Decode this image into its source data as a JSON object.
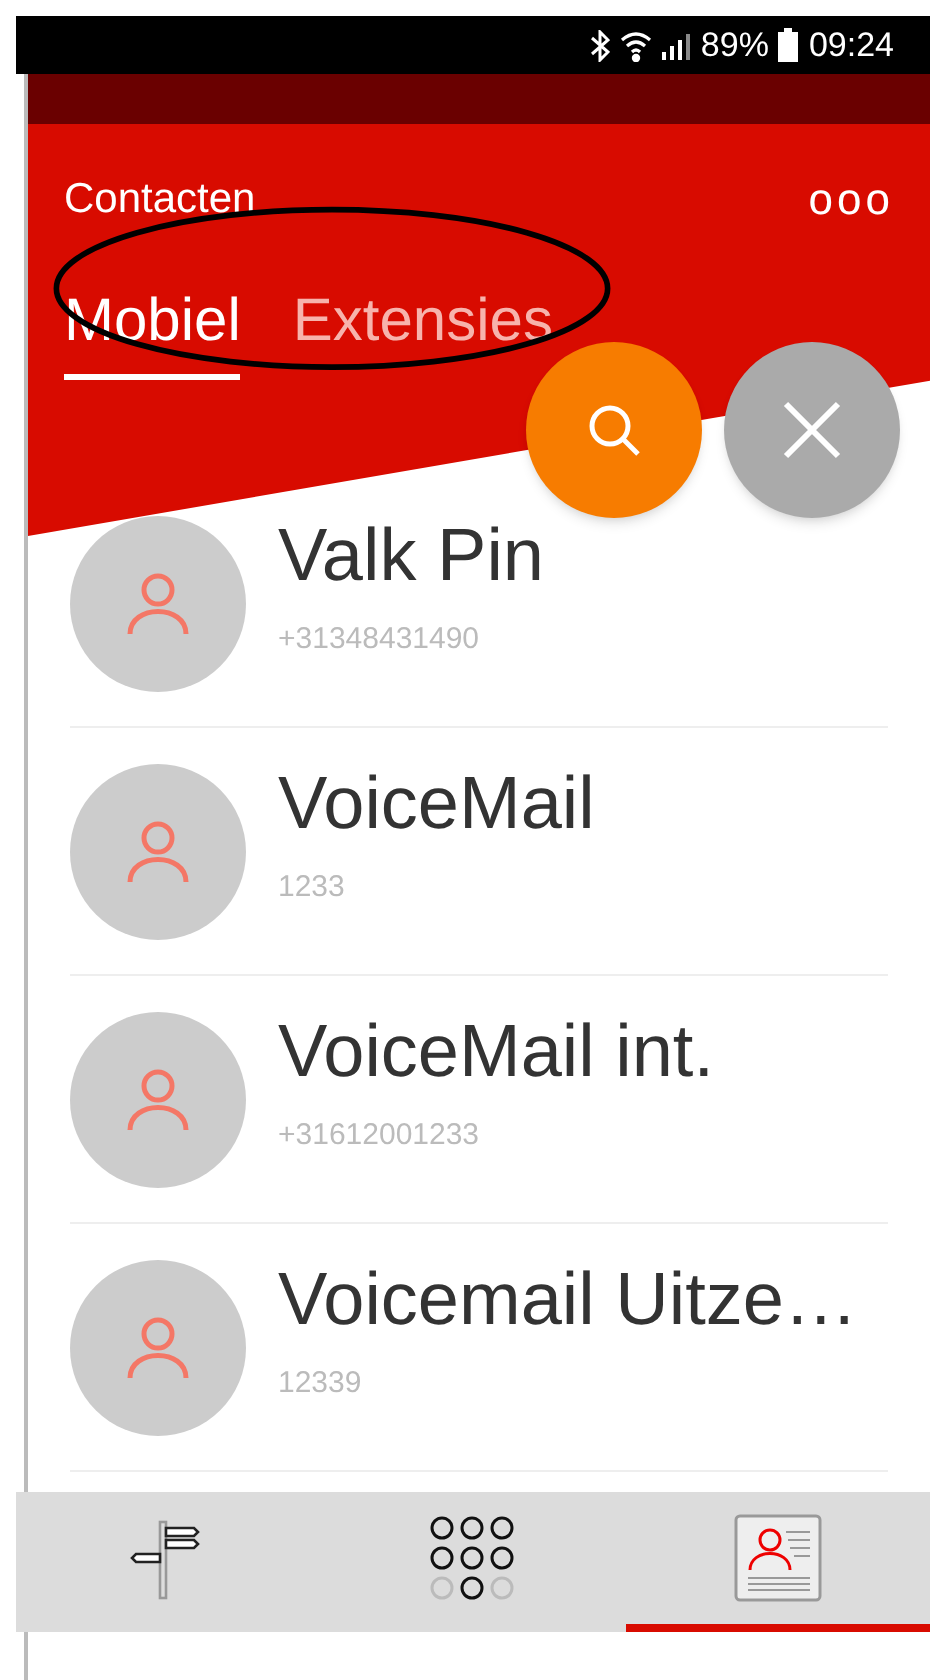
{
  "status_bar": {
    "battery": "89%",
    "time": "09:24"
  },
  "header": {
    "title": "Contacten",
    "menu": "ooo"
  },
  "tabs": [
    {
      "label": "Mobiel",
      "selected": true
    },
    {
      "label": "Extensies",
      "selected": false
    }
  ],
  "contacts": [
    {
      "name": "Valk Pin",
      "number": "+31348431490"
    },
    {
      "name": "VoiceMail",
      "number": "1233"
    },
    {
      "name": "VoiceMail int.",
      "number": "+31612001233"
    },
    {
      "name": "Voicemail Uitze…",
      "number": "12339"
    }
  ],
  "bottom_nav": [
    {
      "kind": "signpost",
      "selected": false
    },
    {
      "kind": "dialpad",
      "selected": false
    },
    {
      "kind": "contacts",
      "selected": true
    }
  ]
}
